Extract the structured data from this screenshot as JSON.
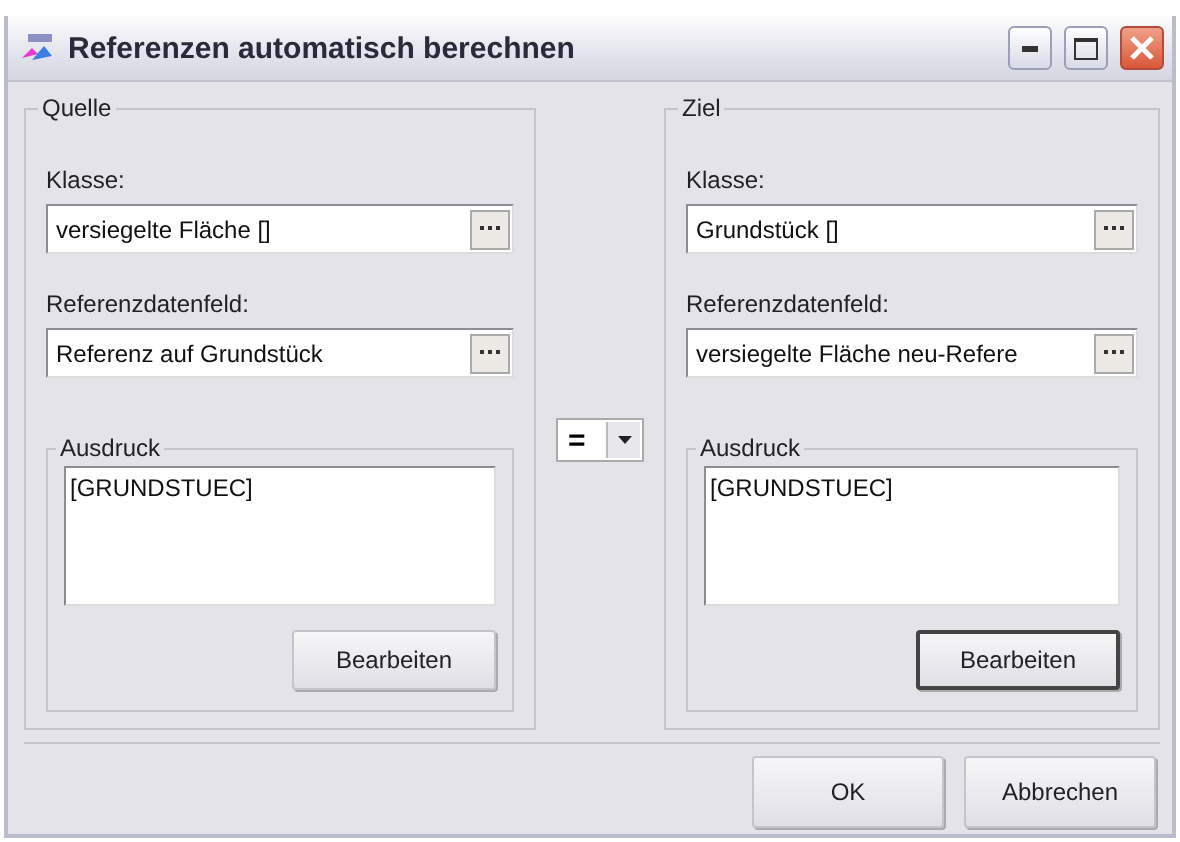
{
  "window": {
    "title": "Referenzen automatisch berechnen"
  },
  "panels": [
    {
      "title": "Quelle",
      "class_label": "Klasse:",
      "class_value": "versiegelte Fläche []",
      "field_label": "Referenzdatenfeld:",
      "field_value": "Referenz auf Grundstück",
      "expression": {
        "title": "Ausdruck",
        "value": "[GRUNDSTUEC]",
        "button": {
          "label": "Bearbeiten",
          "focused": false
        }
      }
    },
    {
      "title": "Ziel",
      "class_label": "Klasse:",
      "class_value": "Grundstück []",
      "field_label": "Referenzdatenfeld:",
      "field_value": "versiegelte Fläche neu-Refere",
      "expression": {
        "title": "Ausdruck",
        "value": "[GRUNDSTUEC]",
        "button": {
          "label": "Bearbeiten",
          "focused": true
        }
      }
    }
  ],
  "operator": {
    "value": "="
  },
  "buttons": [
    {
      "label": "OK"
    },
    {
      "label": "Abbrechen"
    }
  ]
}
